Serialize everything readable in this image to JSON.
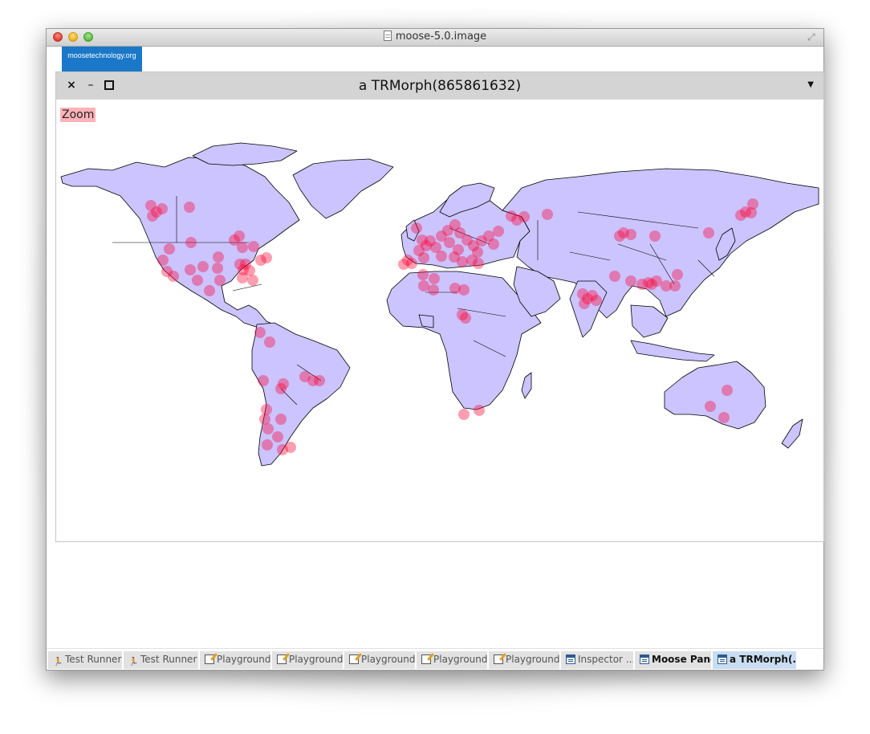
{
  "os_window": {
    "title": "moose-5.0.image"
  },
  "logo": {
    "text": "moosetechnology.org"
  },
  "morph": {
    "title": "a TRMorph(865861632)",
    "zoom_label": "Zoom"
  },
  "colors": {
    "land": "#cbc4ff",
    "border": "#000000",
    "marker": "#ff0033",
    "zoom_bg": "#ffb3b8"
  },
  "taskbar": {
    "tasks": [
      {
        "label": "Test Runner",
        "icon": "runner-icon"
      },
      {
        "label": "Test Runner",
        "icon": "runner-icon"
      },
      {
        "label": "Playground",
        "icon": "playground-icon"
      },
      {
        "label": "Playground",
        "icon": "playground-icon"
      },
      {
        "label": "Playground",
        "icon": "playground-icon"
      },
      {
        "label": "Playground",
        "icon": "playground-icon"
      },
      {
        "label": "Playground",
        "icon": "playground-icon"
      },
      {
        "label": "Inspector ...",
        "icon": "window-icon"
      },
      {
        "label": "Moose Panel",
        "icon": "window-icon"
      },
      {
        "label": "a TRMorph(...",
        "icon": "window-icon"
      }
    ]
  }
}
